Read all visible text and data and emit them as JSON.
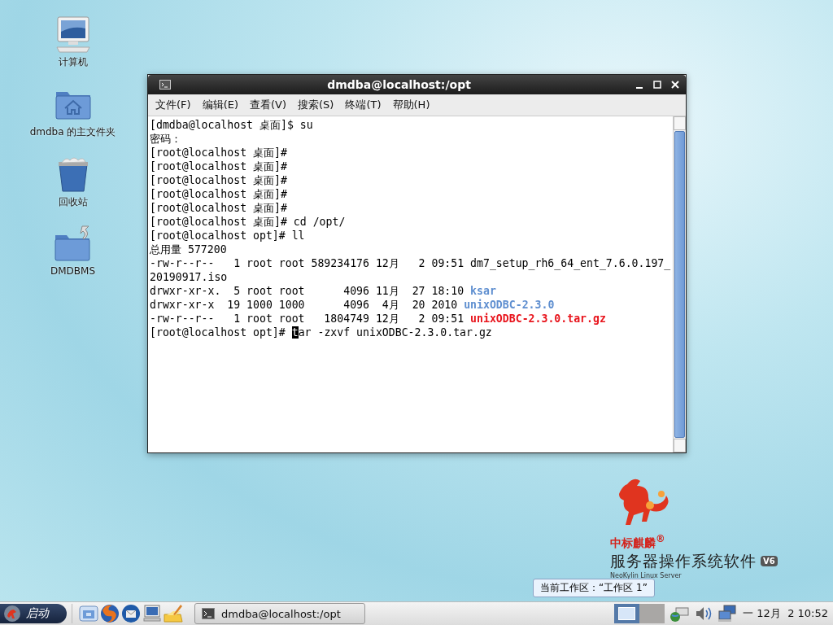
{
  "desktop_icons": [
    {
      "kind": "computer",
      "label": "计算机"
    },
    {
      "kind": "home",
      "label": "dmdba 的主文件夹"
    },
    {
      "kind": "trash",
      "label": "回收站"
    },
    {
      "kind": "link-folder",
      "label": "DMDBMS"
    }
  ],
  "window": {
    "title": "dmdba@localhost:/opt",
    "menu": [
      "文件(F)",
      "编辑(E)",
      "查看(V)",
      "搜索(S)",
      "终端(T)",
      "帮助(H)"
    ],
    "lines": [
      [
        {
          "kind": "plain",
          "text": "[dmdba@localhost 桌面]$ su"
        }
      ],
      [
        {
          "kind": "plain",
          "text": "密码："
        }
      ],
      [
        {
          "kind": "plain",
          "text": "[root@localhost 桌面]#"
        }
      ],
      [
        {
          "kind": "plain",
          "text": "[root@localhost 桌面]#"
        }
      ],
      [
        {
          "kind": "plain",
          "text": "[root@localhost 桌面]#"
        }
      ],
      [
        {
          "kind": "plain",
          "text": "[root@localhost 桌面]#"
        }
      ],
      [
        {
          "kind": "plain",
          "text": "[root@localhost 桌面]#"
        }
      ],
      [
        {
          "kind": "plain",
          "text": "[root@localhost 桌面]# cd /opt/"
        }
      ],
      [
        {
          "kind": "plain",
          "text": "[root@localhost opt]# ll"
        }
      ],
      [
        {
          "kind": "plain",
          "text": "总用量 577200"
        }
      ],
      [
        {
          "kind": "plain",
          "text": "-rw-r--r--   1 root root 589234176 12月   2 09:51 dm7_setup_rh6_64_ent_7.6.0.197_"
        }
      ],
      [
        {
          "kind": "plain",
          "text": "20190917.iso"
        }
      ],
      [
        {
          "kind": "plain",
          "text": "drwxr-xr-x.  5 root root      4096 11月  27 18:10 "
        },
        {
          "kind": "directory",
          "text": "ksar"
        }
      ],
      [
        {
          "kind": "plain",
          "text": "drwxr-xr-x  19 1000 1000      4096  4月  20 2010 "
        },
        {
          "kind": "directory",
          "text": "unixODBC-2.3.0"
        }
      ],
      [
        {
          "kind": "plain",
          "text": "-rw-r--r--   1 root root   1804749 12月   2 09:51 "
        },
        {
          "kind": "archive",
          "text": "unixODBC-2.3.0.tar.gz"
        }
      ],
      [
        {
          "kind": "plain",
          "text": "[root@localhost opt]# "
        },
        {
          "kind": "cursor",
          "text": "t"
        },
        {
          "kind": "plain",
          "text": "ar -zxvf unixODBC-2.3.0.tar.gz"
        }
      ]
    ]
  },
  "logo": {
    "brand": "中标麒麟$^{®}$",
    "product": "服务器操作系统软件",
    "version": "V6",
    "subtitle": "NeoKylin Linux Server"
  },
  "tooltip": "当前工作区：“工作区 1”",
  "taskbar": {
    "start": "启动",
    "launchers": [
      {
        "kind": "folder"
      },
      {
        "kind": "browser"
      },
      {
        "kind": "mail"
      },
      {
        "kind": "computer"
      },
      {
        "kind": "notes"
      }
    ],
    "task": "dmdba@localhost:/opt",
    "workspaces": [
      {
        "selected": true
      },
      {
        "selected": false
      }
    ],
    "clock": "一 12月  2 10:52"
  }
}
